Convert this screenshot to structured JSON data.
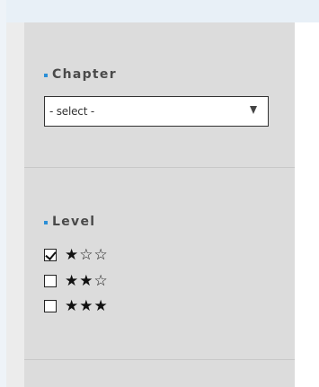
{
  "chapter": {
    "title": "Chapter",
    "select_value": "- select -"
  },
  "level": {
    "title": "Level",
    "options": [
      {
        "stars": "★☆☆",
        "checked": true
      },
      {
        "stars": "★★☆",
        "checked": false
      },
      {
        "stars": "★★★",
        "checked": false
      }
    ]
  },
  "colors": {
    "bullet": "#2b8fd6",
    "panel": "#dcdcdc",
    "page": "#e8f0f7"
  }
}
